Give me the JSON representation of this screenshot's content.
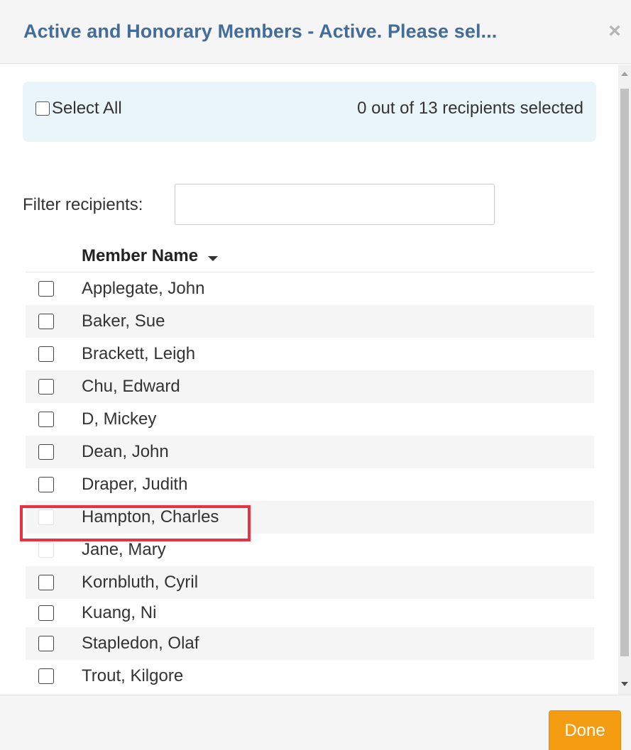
{
  "modal": {
    "title": "Active and Honorary Members - Active. Please sel...",
    "close_symbol": "×"
  },
  "selection": {
    "select_all_label": "Select All",
    "count": "0 out of 13",
    "count_suffix": "recipients selected"
  },
  "filter": {
    "label": "Filter recipients:",
    "value": "",
    "placeholder": ""
  },
  "table": {
    "column_header": "Member Name",
    "sort_icon": "caret-down-icon",
    "rows": [
      {
        "name": "Applegate, John",
        "checked": false,
        "disabled": false
      },
      {
        "name": "Baker, Sue",
        "checked": false,
        "disabled": false
      },
      {
        "name": "Brackett, Leigh",
        "checked": false,
        "disabled": false
      },
      {
        "name": "Chu, Edward",
        "checked": false,
        "disabled": false
      },
      {
        "name": "D, Mickey",
        "checked": false,
        "disabled": false
      },
      {
        "name": "Dean, John",
        "checked": false,
        "disabled": false
      },
      {
        "name": "Draper, Judith",
        "checked": false,
        "disabled": false
      },
      {
        "name": "Hampton, Charles",
        "checked": false,
        "disabled": true
      },
      {
        "name": "Jane, Mary",
        "checked": false,
        "disabled": true
      },
      {
        "name": "Kornbluth, Cyril",
        "checked": false,
        "disabled": false
      },
      {
        "name": "Kuang, Ni",
        "checked": false,
        "disabled": false
      },
      {
        "name": "Stapledon, Olaf",
        "checked": false,
        "disabled": false
      },
      {
        "name": "Trout, Kilgore",
        "checked": false,
        "disabled": false
      }
    ]
  },
  "footer": {
    "done_label": "Done"
  },
  "colors": {
    "title": "#446c98",
    "selection_bar": "#eaf5fa",
    "done_button": "#f39c12",
    "highlight": "#e8323f"
  }
}
